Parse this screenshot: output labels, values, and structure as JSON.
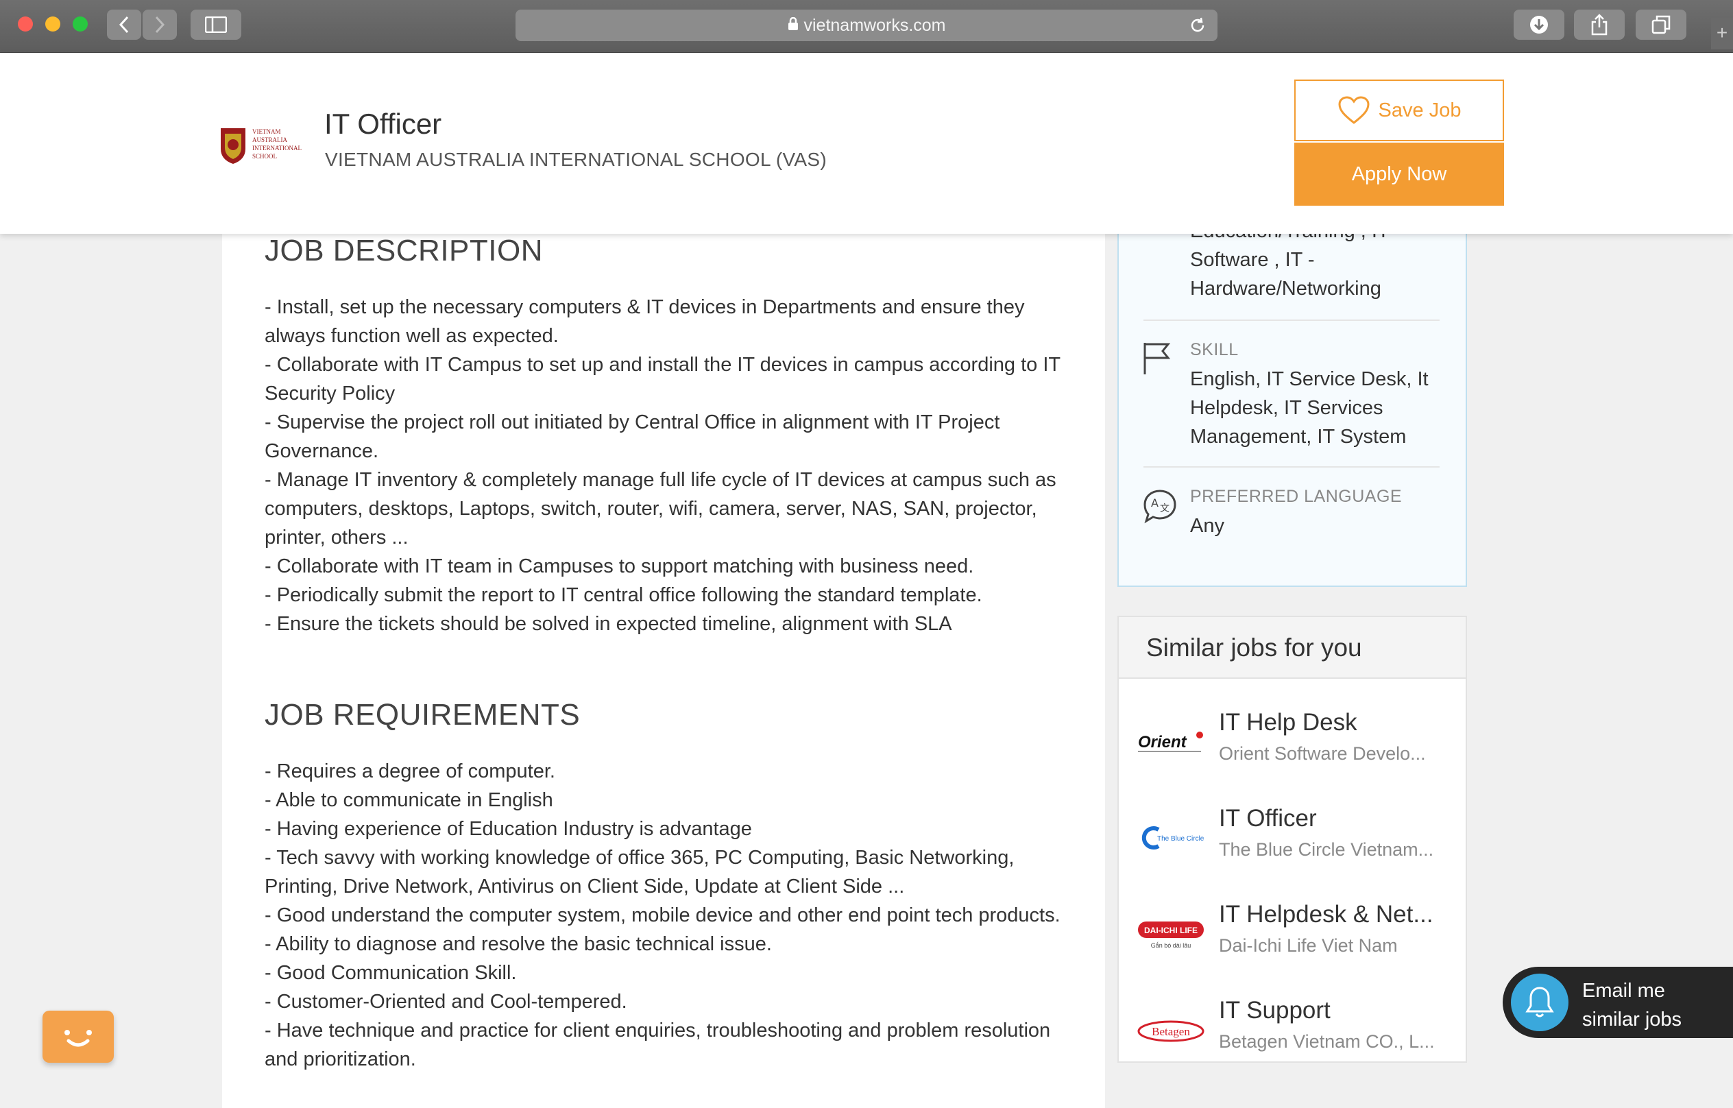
{
  "browser": {
    "url": "vietnamworks.com"
  },
  "header": {
    "logo_text": [
      "VIETNAM",
      "AUSTRALIA",
      "INTERNATIONAL",
      "SCHOOL"
    ],
    "job_title": "IT Officer",
    "company": "VIETNAM AUSTRALIA INTERNATIONAL SCHOOL (VAS)",
    "save_label": "Save Job",
    "apply_label": "Apply Now"
  },
  "description": {
    "title": "JOB DESCRIPTION",
    "lines": [
      "- Install, set up the necessary computers & IT devices in Departments and ensure they always function well as expected.",
      "- Collaborate with IT Campus to set up and install the IT devices in campus according to IT Security Policy",
      "- Supervise the project roll out initiated by Central Office in alignment with IT Project Governance.",
      "- Manage IT inventory & completely manage full life cycle of IT devices at campus such as computers, desktops, Laptops, switch, router, wifi, camera, server, NAS, SAN, projector, printer, others ...",
      "- Collaborate with IT team in Campuses to support matching with business need.",
      "- Periodically submit the report to IT central office following the standard template.",
      "- Ensure the tickets should be solved in expected timeline, alignment with SLA"
    ]
  },
  "requirements": {
    "title": "JOB REQUIREMENTS",
    "lines": [
      "- Requires a degree of computer.",
      "- Able to communicate in English",
      "- Having experience of Education Industry is advantage",
      "- Tech savvy with working knowledge of office 365, PC Computing, Basic Networking, Printing, Drive Network, Antivirus on Client Side, Update at Client Side ...",
      "- Good understand the computer system, mobile device and other end point tech products.",
      "- Ability to diagnose and resolve the basic technical issue.",
      "- Good Communication Skill.",
      "- Customer-Oriented and Cool-tempered.",
      "- Have technique and practice for client enquiries, troubleshooting and problem resolution and prioritization."
    ]
  },
  "sidebar": {
    "industry_partial": "Education/Training , IT",
    "industry_lines": [
      "Software ,  IT -",
      "Hardware/Networking"
    ],
    "skill_label": "SKILL",
    "skill_lines": [
      "English, IT Service Desk, It",
      "Helpdesk, IT Services",
      "Management, IT System"
    ],
    "language_label": "PREFERRED LANGUAGE",
    "language_value": "Any"
  },
  "similar_jobs": {
    "title": "Similar jobs for you",
    "items": [
      {
        "title": "IT Help Desk",
        "company": "Orient Software Develo...",
        "logo": "Orient"
      },
      {
        "title": "IT Officer",
        "company": "The Blue Circle Vietnam...",
        "logo": "The Blue Circle"
      },
      {
        "title": "IT Helpdesk & Net...",
        "company": "Dai-Ichi Life Viet Nam",
        "logo": "DAI-ICHI LIFE",
        "logo_sub": "Gắn bó dài lâu"
      },
      {
        "title": "IT Support",
        "company": "Betagen Vietnam CO., L...",
        "logo": "Betagen"
      }
    ]
  },
  "email_widget": {
    "lines": [
      "Email me",
      "similar jobs"
    ]
  },
  "colors": {
    "accent": "#f39c32",
    "info_border": "#bfe0f0",
    "bell": "#3aa8dc"
  }
}
